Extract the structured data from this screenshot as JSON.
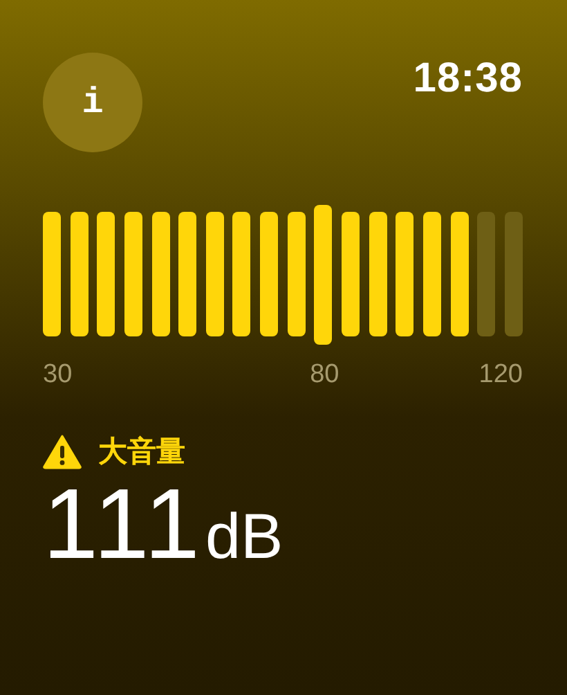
{
  "status_bar": {
    "time": "18:38"
  },
  "info_button": {
    "label": "i"
  },
  "meter": {
    "segments": [
      {
        "lit": true,
        "peak": false
      },
      {
        "lit": true,
        "peak": false
      },
      {
        "lit": true,
        "peak": false
      },
      {
        "lit": true,
        "peak": false
      },
      {
        "lit": true,
        "peak": false
      },
      {
        "lit": true,
        "peak": false
      },
      {
        "lit": true,
        "peak": false
      },
      {
        "lit": true,
        "peak": false
      },
      {
        "lit": true,
        "peak": false
      },
      {
        "lit": true,
        "peak": false
      },
      {
        "lit": true,
        "peak": true
      },
      {
        "lit": true,
        "peak": false
      },
      {
        "lit": true,
        "peak": false
      },
      {
        "lit": true,
        "peak": false
      },
      {
        "lit": true,
        "peak": false
      },
      {
        "lit": true,
        "peak": false
      },
      {
        "lit": false,
        "peak": false
      },
      {
        "lit": false,
        "peak": false
      }
    ],
    "ticks": [
      "30",
      "80",
      "120"
    ]
  },
  "warning": {
    "label": "大音量"
  },
  "reading": {
    "value": "111",
    "unit": "dB"
  }
}
